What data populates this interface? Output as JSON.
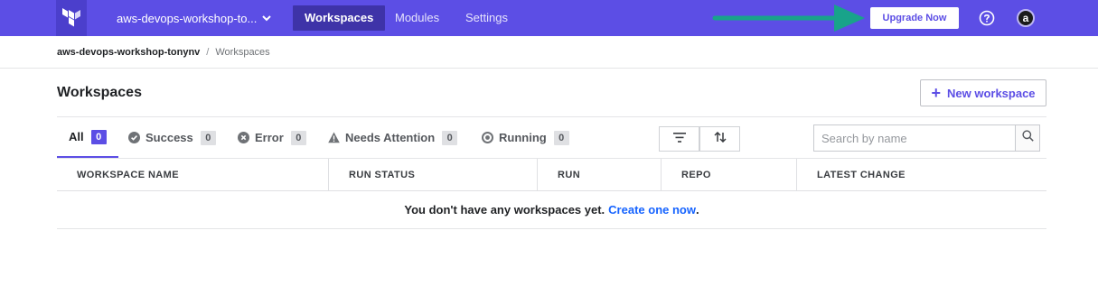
{
  "topnav": {
    "logo_icon": "terraform-logo-icon",
    "org_name": "aws-devops-workshop-to...",
    "tabs": [
      {
        "label": "Workspaces",
        "active": true
      },
      {
        "label": "Modules",
        "active": false
      },
      {
        "label": "Settings",
        "active": false
      }
    ],
    "upgrade_label": "Upgrade Now",
    "help_icon": "question-circle-icon",
    "avatar_letter": "a",
    "accent_color": "#5c4ee5",
    "annotation_arrow_color": "#18a38a"
  },
  "breadcrumb": {
    "org": "aws-devops-workshop-tonynv",
    "separator": "/",
    "current": "Workspaces"
  },
  "header": {
    "title": "Workspaces",
    "new_workspace_label": "New workspace"
  },
  "filters": {
    "tabs": [
      {
        "label": "All",
        "count": "0",
        "icon": "",
        "active": true
      },
      {
        "label": "Success",
        "count": "0",
        "icon": "check-circle-icon",
        "active": false
      },
      {
        "label": "Error",
        "count": "0",
        "icon": "x-circle-icon",
        "active": false
      },
      {
        "label": "Needs Attention",
        "count": "0",
        "icon": "warning-triangle-icon",
        "active": false
      },
      {
        "label": "Running",
        "count": "0",
        "icon": "running-circle-icon",
        "active": false
      }
    ],
    "filter_icon": "filter-icon",
    "sort_icon": "sort-icon",
    "search_placeholder": "Search by name",
    "search_value": "",
    "search_icon": "search-icon"
  },
  "table": {
    "columns": [
      "WORKSPACE NAME",
      "RUN STATUS",
      "RUN",
      "REPO",
      "LATEST CHANGE"
    ],
    "empty_message": "You don't have any workspaces yet.",
    "empty_link": "Create one now",
    "empty_suffix": "."
  }
}
